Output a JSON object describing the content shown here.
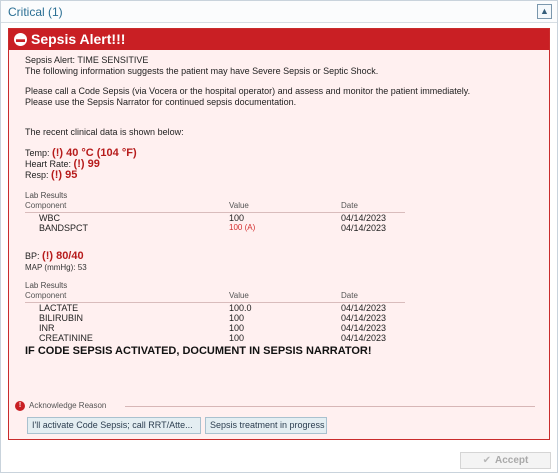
{
  "section": {
    "title": "Critical (1)",
    "collapse_icon": "double-chevron-up-icon"
  },
  "alert": {
    "title": "Sepsis Alert!!!",
    "header_line": "Sepsis Alert:  TIME SENSITIVE",
    "intro": "The following information suggests the patient may have Severe Sepsis or Septic Shock.",
    "instruction_1": "Please call a Code Sepsis (via Vocera or the hospital operator) and assess and monitor the patient immediately.",
    "instruction_2": "Please use the Sepsis Narrator for continued sepsis documentation.",
    "recent_data": "The recent clinical data is shown below:",
    "vitals": [
      {
        "label": "Temp:",
        "value": "(!) 40 °C (104 °F)"
      },
      {
        "label": "Heart Rate:",
        "value": "(!) 99"
      },
      {
        "label": "Resp:",
        "value": "(!) 95"
      }
    ],
    "labs_1": {
      "title": "Lab Results",
      "headers": [
        "Component",
        "Value",
        "Date"
      ],
      "rows": [
        {
          "component": "WBC",
          "value": "100",
          "date": "04/14/2023",
          "abnormal": false
        },
        {
          "component": "BANDSPCT",
          "value": "100 (A)",
          "date": "04/14/2023",
          "abnormal": true
        }
      ]
    },
    "bp": {
      "label": "BP:",
      "value": "(!) 80/40"
    },
    "map": "MAP (mmHg): 53",
    "labs_2": {
      "title": "Lab Results",
      "headers": [
        "Component",
        "Value",
        "Date"
      ],
      "rows": [
        {
          "component": "LACTATE",
          "value": "100.0",
          "date": "04/14/2023",
          "abnormal": false
        },
        {
          "component": "BILIRUBIN",
          "value": "100",
          "date": "04/14/2023",
          "abnormal": false
        },
        {
          "component": "INR",
          "value": "100",
          "date": "04/14/2023",
          "abnormal": false
        },
        {
          "component": "CREATININE",
          "value": "100",
          "date": "04/14/2023",
          "abnormal": false
        }
      ]
    },
    "directive": "IF CODE SEPSIS ACTIVATED, DOCUMENT IN SEPSIS NARRATOR!"
  },
  "acknowledge": {
    "label": "Acknowledge Reason",
    "reasons": [
      "I'll activate Code Sepsis; call RRT/Atte...",
      "Sepsis treatment in progress"
    ]
  },
  "footer": {
    "accept_label": "Accept"
  },
  "colors": {
    "alert_red": "#c91f24",
    "alert_background": "#fff0f0",
    "abnormal_red": "#b71c1c",
    "header_blue": "#2b6f94"
  }
}
